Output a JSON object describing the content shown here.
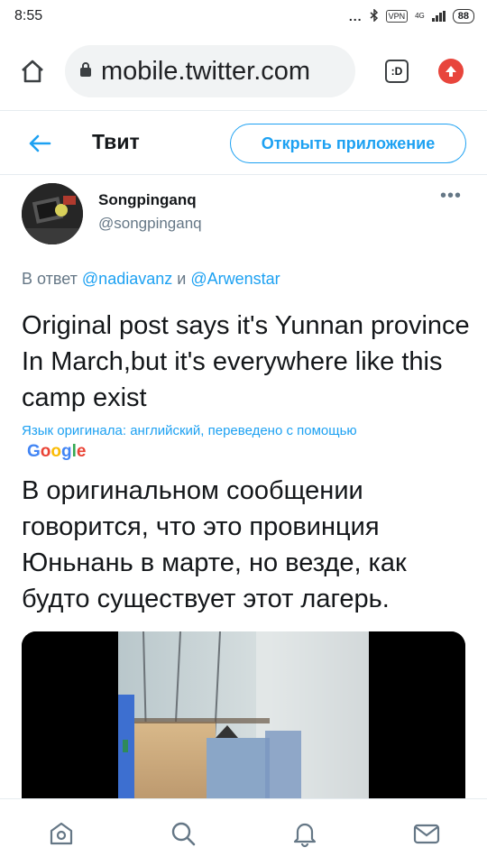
{
  "status_bar": {
    "time": "8:55",
    "dots": "...",
    "vpn": "VPN",
    "network": "4G",
    "battery": "88"
  },
  "browser": {
    "url": "mobile.twitter.com",
    "tabs_label": ":D"
  },
  "header": {
    "title": "Твит",
    "open_app": "Открыть приложение"
  },
  "tweet": {
    "author_name": "Songpinganq",
    "author_handle": "@songpinganq",
    "more": "•••",
    "reply_prefix": "В ответ",
    "reply_mention_1": "@nadiavanz",
    "reply_and": "и",
    "reply_mention_2": "@Arwenstar",
    "text": "Original post says it's Yunnan province In March,but it's everywhere like this camp exist",
    "translation_note": "Язык оригинала: английский, переведено с помощью",
    "translation_provider": "Google",
    "translated_text": "В оригинальном сообщении говорится, что это провинция Юньнань в марте, но везде, как будто существует этот лагерь."
  },
  "bottom_nav": {
    "items": [
      "home-icon",
      "search-icon",
      "notifications-icon",
      "messages-icon"
    ]
  },
  "colors": {
    "accent": "#1da1f2",
    "secondary_text": "#657786",
    "text": "#14171a",
    "update_badge": "#e8453c"
  }
}
